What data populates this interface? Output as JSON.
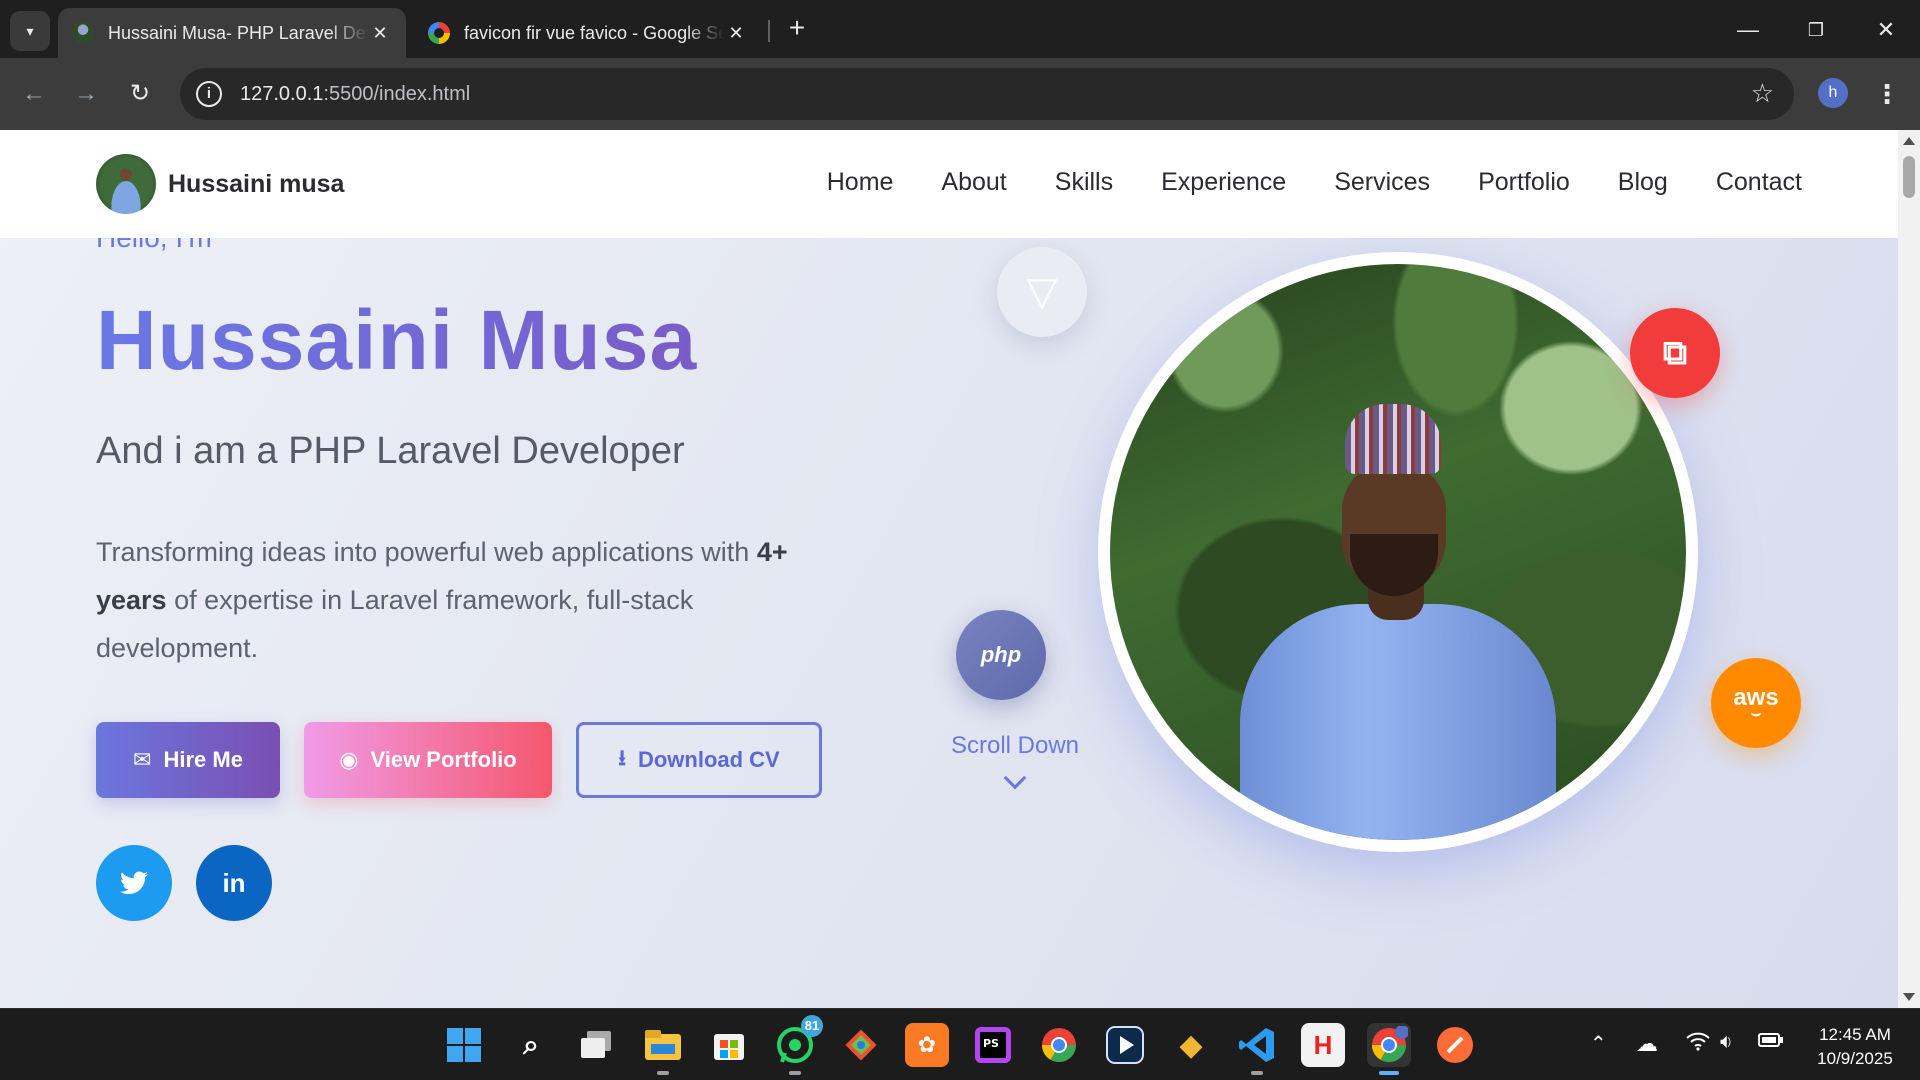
{
  "browser": {
    "tabs": [
      {
        "title": "Hussaini Musa- PHP Laravel Developer",
        "active": true
      },
      {
        "title": "favicon fir vue favico - Google Search",
        "active": false
      }
    ],
    "url_host": "127.0.0.1",
    "url_path": ":5500/index.html",
    "profile_initial": "h",
    "close_glyph": "✕",
    "new_tab_glyph": "+"
  },
  "site": {
    "brand_name": "Hussaini musa",
    "nav": [
      "Home",
      "About",
      "Skills",
      "Experience",
      "Services",
      "Portfolio",
      "Blog",
      "Contact"
    ]
  },
  "hero": {
    "greeting": "Hello, I'm",
    "name": "Hussaini Musa",
    "role": "And i am a PHP Laravel Developer",
    "desc_part1": "Transforming ideas into powerful web applications with ",
    "desc_bold": "4+ years",
    "desc_part2": " of expertise in Laravel framework, full-stack development.",
    "buttons": {
      "hire": "Hire Me",
      "portfolio": "View Portfolio",
      "cv": "Download CV"
    },
    "social": {
      "twitter": "twitter-icon",
      "linkedin": "in"
    },
    "floating_badges": {
      "vue": "vue-icon",
      "php": "php",
      "laravel": "laravel-icon",
      "aws": "aws"
    },
    "scroll_label": "Scroll Down"
  },
  "taskbar": {
    "whatsapp_badge": "81",
    "time": "12:45 AM",
    "date": "10/9/2025"
  },
  "colors": {
    "accent": "#6a78e0",
    "hire_gradient": [
      "#6b77de",
      "#7a4fb2"
    ],
    "portfolio_gradient": [
      "#f09be8",
      "#f5576c"
    ],
    "twitter": "#1d9bf0",
    "linkedin": "#0a66c2",
    "laravel": "#f23b3b",
    "aws": "#ff8a00"
  }
}
